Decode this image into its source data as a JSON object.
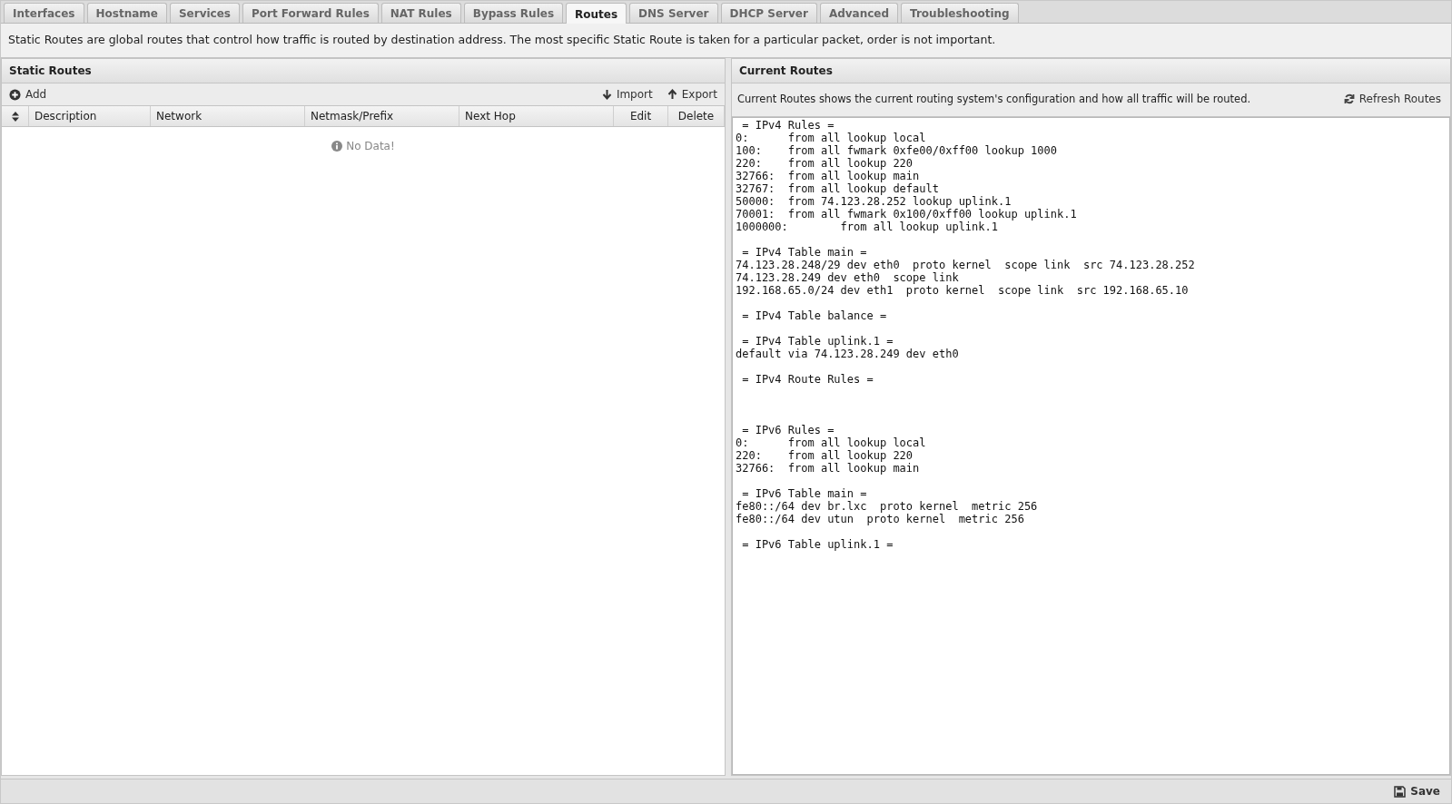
{
  "tabs": [
    {
      "label": "Interfaces",
      "selected": false
    },
    {
      "label": "Hostname",
      "selected": false
    },
    {
      "label": "Services",
      "selected": false
    },
    {
      "label": "Port Forward Rules",
      "selected": false
    },
    {
      "label": "NAT Rules",
      "selected": false
    },
    {
      "label": "Bypass Rules",
      "selected": false
    },
    {
      "label": "Routes",
      "selected": true
    },
    {
      "label": "DNS Server",
      "selected": false
    },
    {
      "label": "DHCP Server",
      "selected": false
    },
    {
      "label": "Advanced",
      "selected": false
    },
    {
      "label": "Troubleshooting",
      "selected": false
    }
  ],
  "description": "Static Routes are global routes that control how traffic is routed by destination address. The most specific Static Route is taken for a particular packet, order is not important.",
  "static_routes": {
    "title": "Static Routes",
    "add_label": "Add",
    "import_label": "Import",
    "export_label": "Export",
    "columns": [
      "Description",
      "Network",
      "Netmask/Prefix",
      "Next Hop",
      "Edit",
      "Delete"
    ],
    "empty_text": "No Data!"
  },
  "current_routes": {
    "title": "Current Routes",
    "info": "Current Routes shows the current routing system's configuration and how all traffic will be routed.",
    "refresh_label": "Refresh Routes",
    "output": " = IPv4 Rules =\n0:\tfrom all lookup local\n100:\tfrom all fwmark 0xfe00/0xff00 lookup 1000\n220:\tfrom all lookup 220\n32766:\tfrom all lookup main\n32767:\tfrom all lookup default\n50000:\tfrom 74.123.28.252 lookup uplink.1\n70001:\tfrom all fwmark 0x100/0xff00 lookup uplink.1\n1000000:\tfrom all lookup uplink.1\n\n = IPv4 Table main =\n74.123.28.248/29 dev eth0  proto kernel  scope link  src 74.123.28.252\n74.123.28.249 dev eth0  scope link\n192.168.65.0/24 dev eth1  proto kernel  scope link  src 192.168.65.10\n\n = IPv4 Table balance =\n\n = IPv4 Table uplink.1 =\ndefault via 74.123.28.249 dev eth0\n\n = IPv4 Route Rules =\n\n\n\n = IPv6 Rules =\n0:\tfrom all lookup local\n220:\tfrom all lookup 220\n32766:\tfrom all lookup main\n\n = IPv6 Table main =\nfe80::/64 dev br.lxc  proto kernel  metric 256\nfe80::/64 dev utun  proto kernel  metric 256\n\n = IPv6 Table uplink.1 ="
  },
  "footer": {
    "save_label": "Save"
  }
}
